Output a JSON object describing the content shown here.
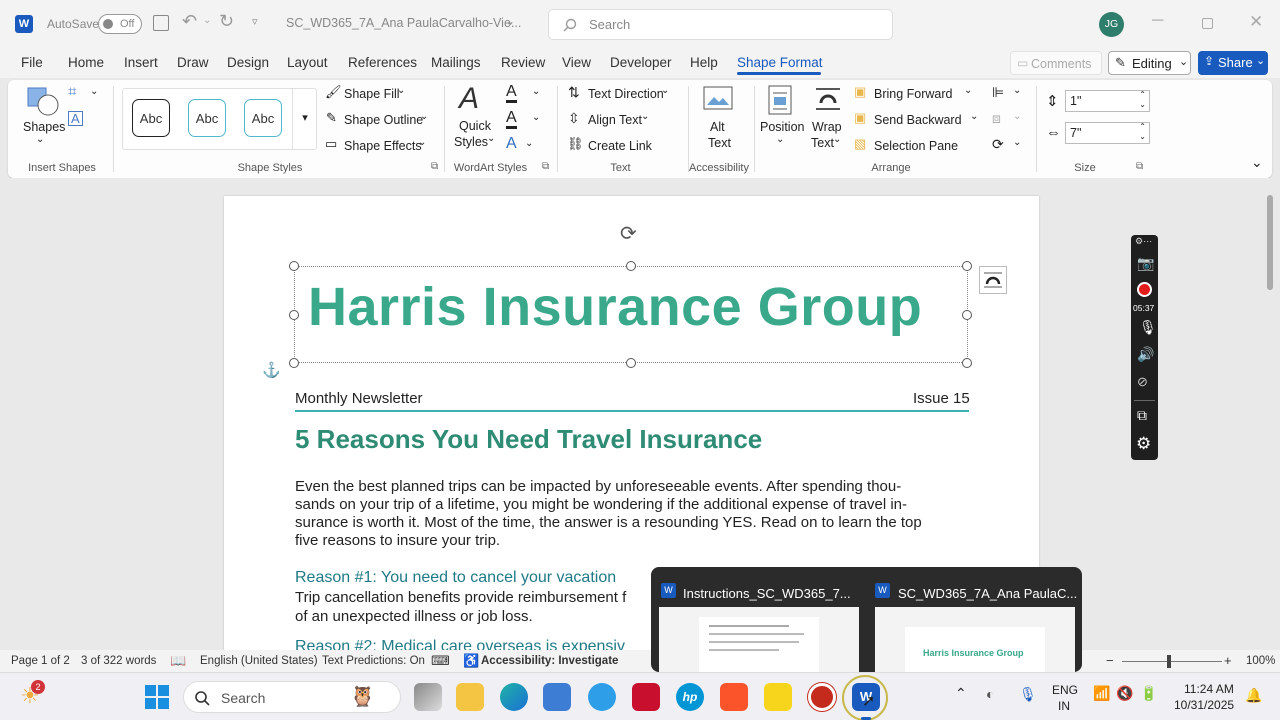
{
  "titlebar": {
    "autosave_label": "AutoSave",
    "autosave_state": "Off",
    "doc_title": "SC_WD365_7A_Ana PaulaCarvalho-Vie...",
    "search_placeholder": "Search",
    "user_initials": "JG"
  },
  "menu": {
    "tabs": [
      "File",
      "Home",
      "Insert",
      "Draw",
      "Design",
      "Layout",
      "References",
      "Mailings",
      "Review",
      "View",
      "Developer",
      "Help",
      "Shape Format"
    ],
    "comments": "Comments",
    "editing": "Editing",
    "share": "Share"
  },
  "ribbon": {
    "shapes": "Shapes",
    "insert_shapes": "Insert Shapes",
    "abc": "Abc",
    "shape_fill": "Shape Fill",
    "shape_outline": "Shape Outline",
    "shape_effects": "Shape Effects",
    "shape_styles": "Shape Styles",
    "quick_styles_1": "Quick",
    "quick_styles_2": "Styles",
    "wordart_styles": "WordArt Styles",
    "text_direction": "Text Direction",
    "align_text": "Align Text",
    "create_link": "Create Link",
    "text_group": "Text",
    "alt_text_1": "Alt",
    "alt_text_2": "Text",
    "accessibility": "Accessibility",
    "position": "Position",
    "wrap_text_1": "Wrap",
    "wrap_text_2": "Text",
    "bring_forward": "Bring Forward",
    "send_backward": "Send Backward",
    "selection_pane": "Selection Pane",
    "arrange": "Arrange",
    "height": "1\"",
    "width": "7\"",
    "size": "Size"
  },
  "document": {
    "title": "Harris Insurance Group",
    "newsletter": "Monthly Newsletter",
    "issue": "Issue 15",
    "heading": "5 Reasons You Need Travel Insurance",
    "para_lines": [
      "Even the best planned trips can be impacted by unforeseeable events. After spending thou-",
      "sands on your trip of a lifetime, you might be wondering if the additional expense of travel in-",
      "surance is worth it.  Most of the time, the answer is a resounding YES. Read on to learn the top",
      "five reasons to insure your trip."
    ],
    "reason1": "Reason #1: You need to cancel your vacation",
    "reason1_line1": "Trip cancellation benefits provide reimbursement f",
    "reason1_line2": "of an unexpected illness or job loss.",
    "reason2": "Reason #2: Medical care overseas is expensiv"
  },
  "recorder": {
    "time": "05:37"
  },
  "preview": {
    "win1_title": "Instructions_SC_WD365_7...",
    "win2_title": "SC_WD365_7A_Ana PaulaC...",
    "thumb2_text": "Harris Insurance Group"
  },
  "status": {
    "page": "Page 1 of 2",
    "words": "3 of 322 words",
    "language": "English (United States)",
    "predictions": "Text Predictions: On",
    "accessibility": "Accessibility: Investigate",
    "zoom": "100%"
  },
  "taskbar": {
    "weather_badge": "2",
    "search": "Search",
    "lang1": "ENG",
    "lang2": "IN",
    "time": "11:24 AM",
    "date": "10/31/2025"
  },
  "colors": {
    "accent": "#185abd",
    "title_teal": "#3aa88a",
    "heading_teal": "#2e8b74"
  }
}
